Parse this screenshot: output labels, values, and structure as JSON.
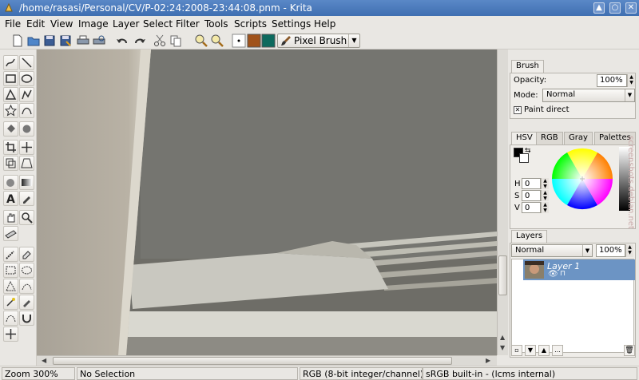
{
  "window": {
    "title": "/home/rasasi/Personal/CV/P-02:24:2008-23:44:08.pnm - Krita",
    "controls": [
      "▲",
      "○",
      "✕"
    ]
  },
  "menu": [
    "File",
    "Edit",
    "View",
    "Image",
    "Layer",
    "Select",
    "Filter",
    "Tools",
    "Scripts",
    "Settings",
    "Help"
  ],
  "toolbar": {
    "brush_label": "Pixel Brush",
    "fg_color": "#a0521a",
    "bg_color": "#0d6a5e"
  },
  "brush_panel": {
    "tab": "Brush",
    "opacity_label": "Opacity:",
    "opacity_value": "100%",
    "mode_label": "Mode:",
    "mode_value": "Normal",
    "paint_direct_label": "Paint direct",
    "paint_direct_checked": true
  },
  "color_panel": {
    "tabs": [
      "HSV",
      "RGB",
      "Gray",
      "Palettes"
    ],
    "h_label": "H",
    "h_value": "0",
    "s_label": "S",
    "s_value": "0",
    "v_label": "V",
    "v_value": "0"
  },
  "layers_panel": {
    "tab": "Layers",
    "mode_value": "Normal",
    "opacity_value": "100%",
    "layers": [
      {
        "name": "Layer 1",
        "selected": true
      }
    ],
    "more_label": "..."
  },
  "status": {
    "zoom": "Zoom 300%",
    "selection": "No Selection",
    "color_model": "RGB (8-bit integer/channel)",
    "profile": "sRGB built-in - (lcms internal)"
  },
  "watermark": "screenshots.debian.net"
}
